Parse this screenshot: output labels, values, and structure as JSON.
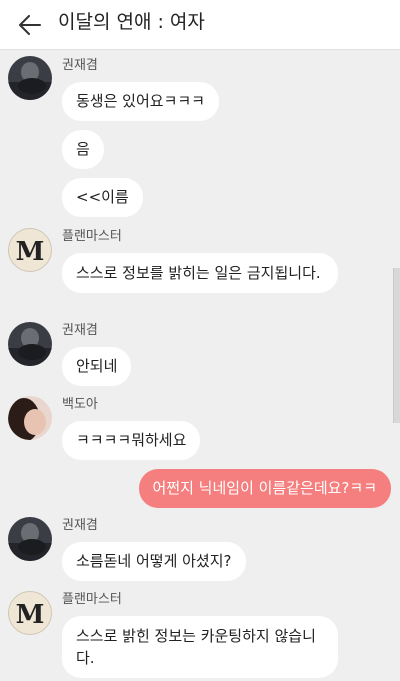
{
  "header": {
    "title": "이달의 연애 : 여자"
  },
  "messages": [
    {
      "sender": "권재겸",
      "text": "동생은 있어요ㅋㅋㅋ"
    },
    {
      "text": "음"
    },
    {
      "text": "<<이름"
    },
    {
      "sender": "플랜마스터",
      "text": "스스로 정보를 밝히는 일은 금지됩니다."
    },
    {
      "sender": "권재겸",
      "text": "안되네"
    },
    {
      "sender": "백도아",
      "text": "ㅋㅋㅋㅋ뭐하세요"
    },
    {
      "text": "어쩐지 닉네임이 이름같은데요?ㅋㅋ"
    },
    {
      "sender": "권재겸",
      "text": "소름돋네 어떻게 아셨지?"
    },
    {
      "sender": "플랜마스터",
      "text": "스스로 밝힌 정보는 카운팅하지 않습니다."
    }
  ],
  "planmaster_logo_letter": "M",
  "colors": {
    "background": "#efefef",
    "header": "#ffffff",
    "incoming_bubble": "#ffffff",
    "outgoing_bubble": "#f57f7f"
  }
}
